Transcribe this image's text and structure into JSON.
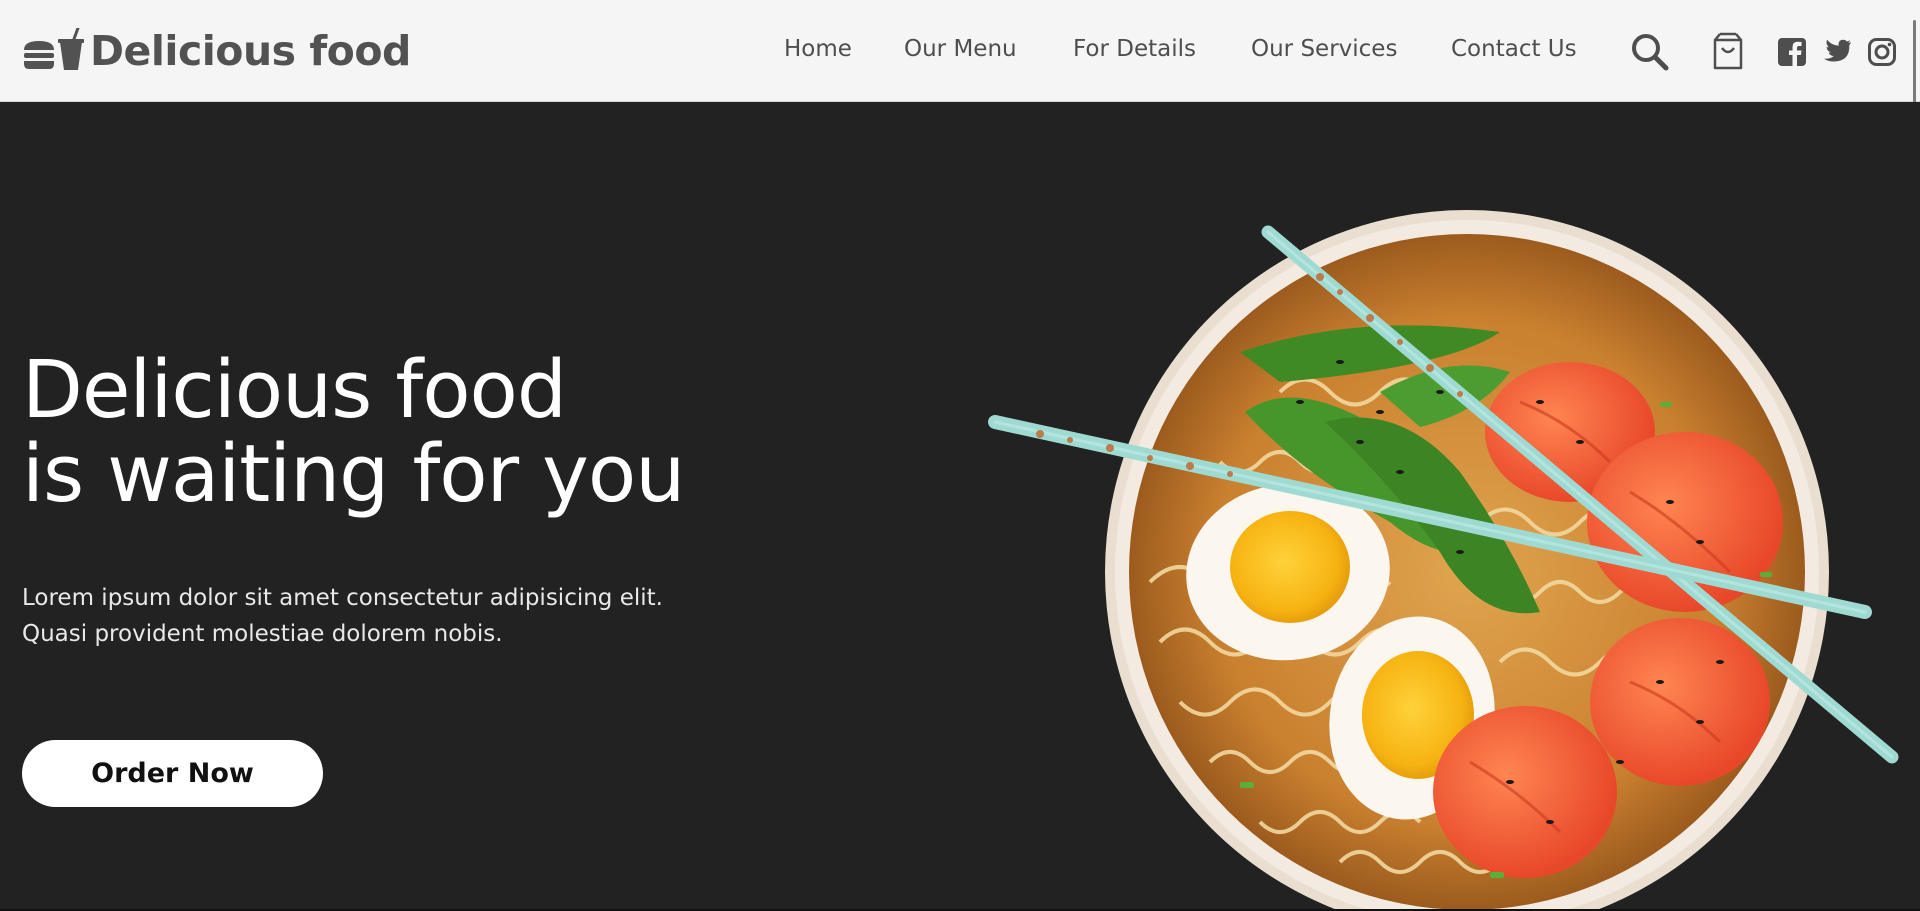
{
  "header": {
    "brand": "Delicious food",
    "nav": [
      {
        "label": "Home"
      },
      {
        "label": "Our Menu"
      },
      {
        "label": "For Details"
      },
      {
        "label": "Our Services"
      },
      {
        "label": "Contact Us"
      }
    ],
    "icons": [
      "search-icon",
      "shopping-bag-icon",
      "facebook-icon",
      "twitter-icon",
      "instagram-icon"
    ]
  },
  "hero": {
    "headline_line1": "Delicious food",
    "headline_line2": "is waiting for you",
    "body_line1": "Lorem ipsum dolor sit amet consectetur adipisicing elit.",
    "body_line2": "Quasi provident molestiae dolorem nobis.",
    "cta": "Order Now"
  },
  "colors": {
    "header_bg": "#f5f5f5",
    "header_text": "#4e4e4e",
    "hero_bg": "#222222",
    "hero_text": "#ffffff",
    "button_bg": "#ffffff",
    "button_text": "#111111"
  }
}
